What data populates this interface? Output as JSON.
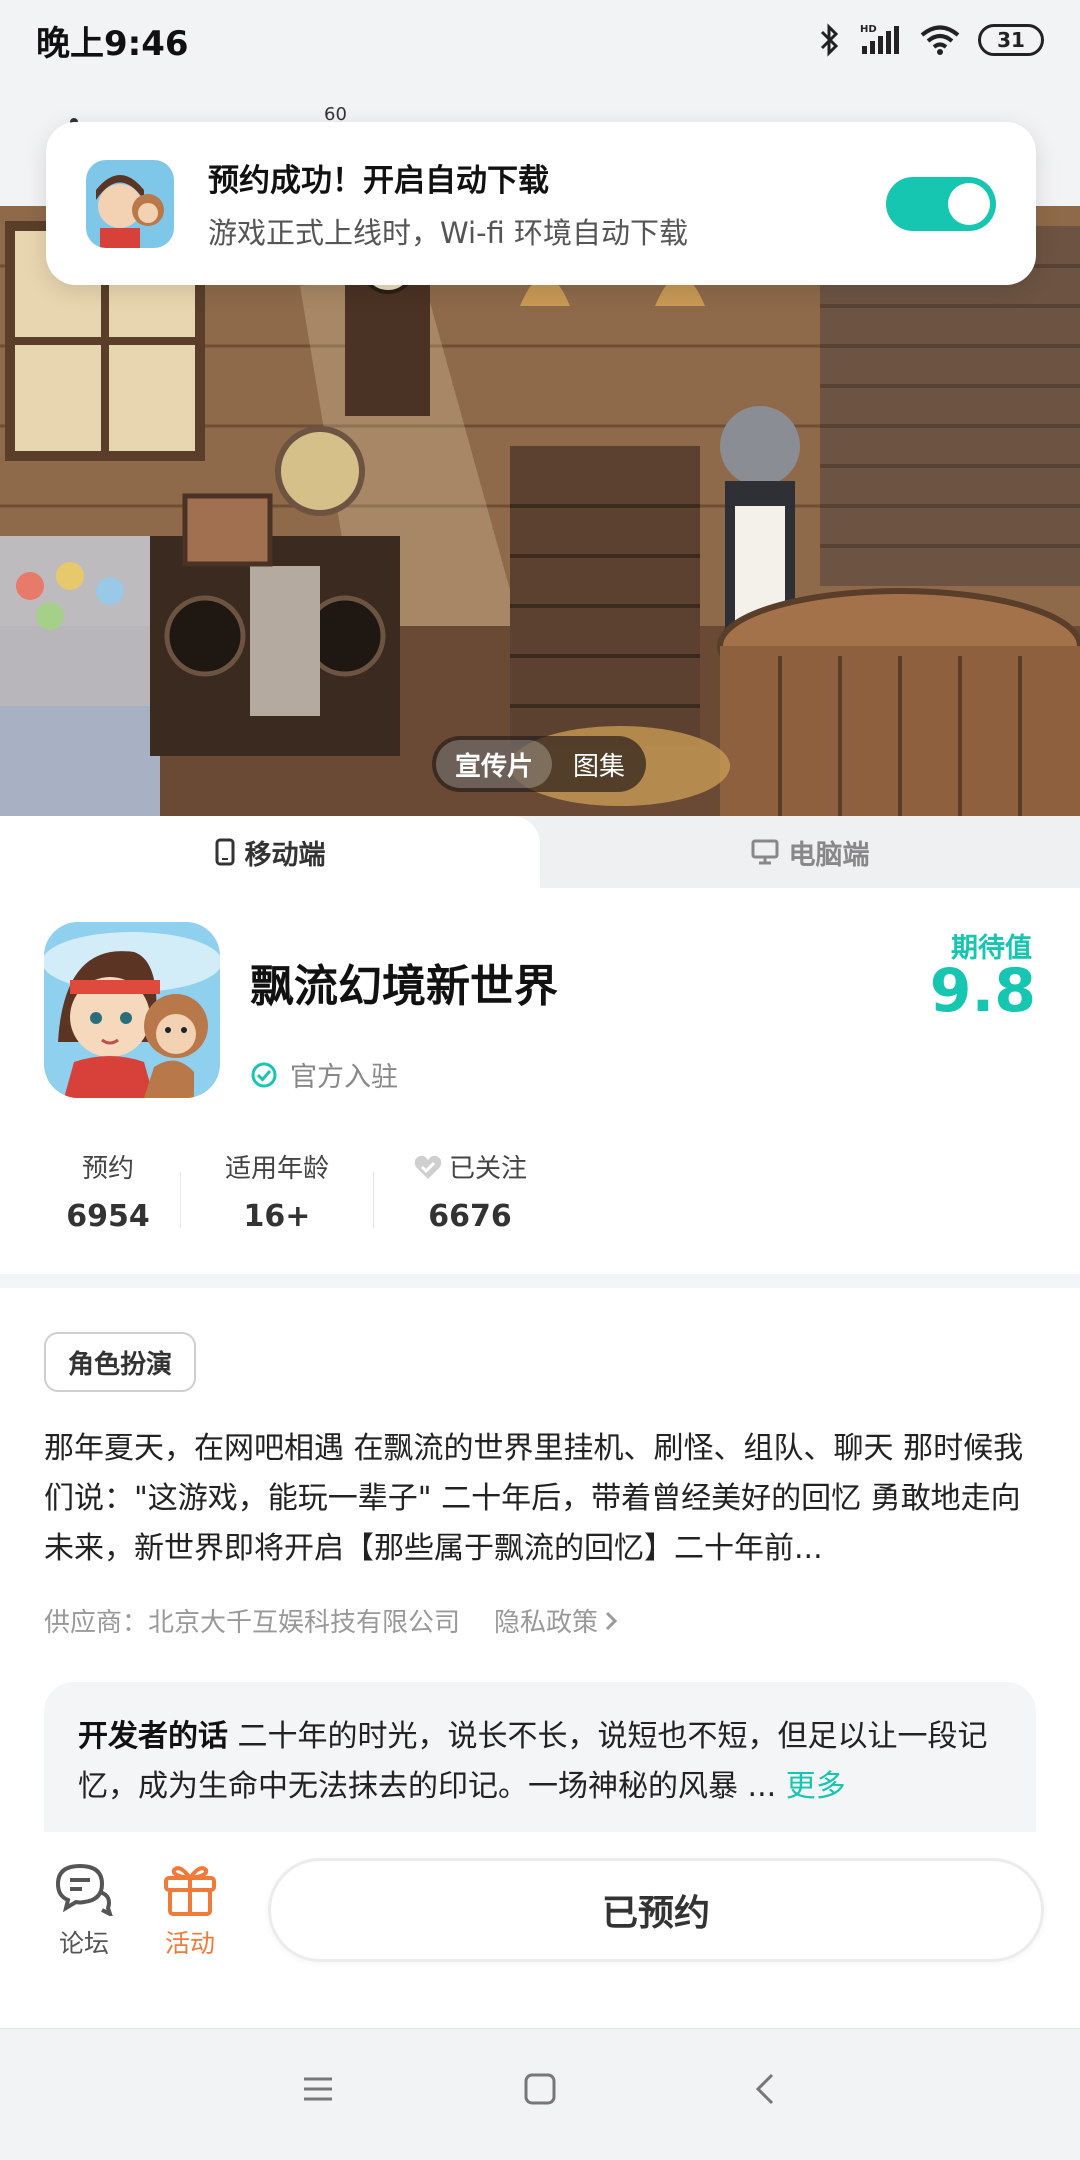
{
  "status_bar": {
    "time": "晚上9:46",
    "battery": "31",
    "icons": [
      "bluetooth-icon",
      "hd-signal-icon",
      "wifi-icon",
      "battery-icon"
    ]
  },
  "header": {
    "mini_text": "60"
  },
  "notification": {
    "title": "预约成功！开启自动下载",
    "subtitle": "游戏正式上线时，Wi-fi 环境自动下载",
    "toggle_on": true
  },
  "media": {
    "tabs": [
      "宣传片",
      "图集"
    ],
    "active": "宣传片"
  },
  "platform_tabs": {
    "mobile": "移动端",
    "pc": "电脑端",
    "active": "mobile"
  },
  "app": {
    "name": "飘流幻境新世界",
    "official_label": "官方入驻",
    "expect_label": "期待值",
    "expect_value": "9.8"
  },
  "stats": [
    {
      "label": "预约",
      "value": "6954"
    },
    {
      "label": "适用年龄",
      "value": "16+"
    },
    {
      "label": "已关注",
      "value": "6676"
    }
  ],
  "tag": "角色扮演",
  "description": "那年夏天，在网吧相遇 在飘流的世界里挂机、刷怪、组队、聊天 那时候我们说：\"这游戏，能玩一辈子\" 二十年后，带着曾经美好的回忆 勇敢地走向未来，新世界即将开启【那些属于飘流的回忆】二十年前...",
  "supplier": "供应商：北京大千互娱科技有限公司",
  "privacy": "隐私政策",
  "dev_note": {
    "title": "开发者的话",
    "text": "二十年的时光，说长不长，说短也不短，但足以让一段记忆，成为生命中无法抹去的印记。一场神秘的风暴 ...",
    "more": "更多"
  },
  "action_bar": {
    "forum": "论坛",
    "activity": "活动",
    "reserved": "已预约"
  },
  "colors": {
    "accent": "#17c6b0",
    "activity": "#f07a3a"
  }
}
